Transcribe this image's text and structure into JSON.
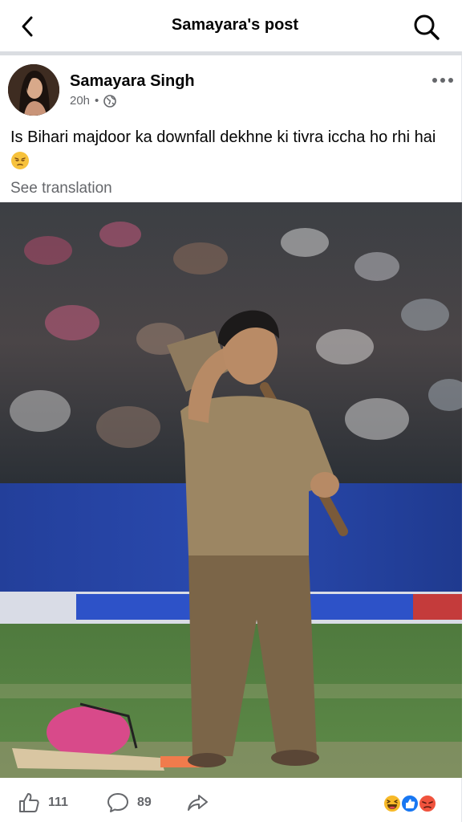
{
  "header": {
    "title": "Samayara's post",
    "back_icon": "chevron-left-icon",
    "search_icon": "search-icon"
  },
  "post": {
    "author": "Samayara Singh",
    "time": "20h",
    "separator": "•",
    "privacy_icon": "globe-icon",
    "more_icon": "more-horizontal-icon",
    "text": "Is Bihari majdoor ka downfall dekhne ki tivra iccha ho rhi hai",
    "emoji": "pensive-face-emoji",
    "see_translation": "See translation"
  },
  "actions": {
    "like_count": "111",
    "comment_count": "89",
    "share_icon": "share-icon"
  },
  "reactions": [
    "haha",
    "like",
    "angry"
  ],
  "colors": {
    "text": "#050505",
    "muted": "#65676b",
    "divider": "#dadde1",
    "like_blue": "#1877f2",
    "angry_orange": "#f0533d",
    "haha_yellow": "#f7b928"
  }
}
